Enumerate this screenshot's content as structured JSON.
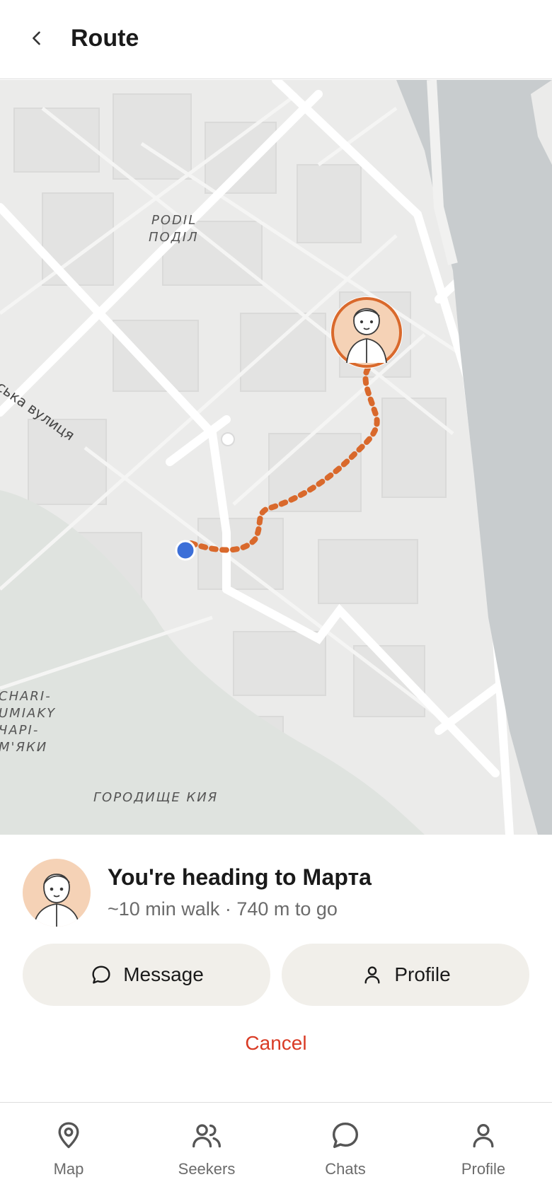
{
  "header": {
    "title": "Route",
    "back_icon": "chevron-left-icon"
  },
  "map": {
    "labels": {
      "district_latin": "PODIL",
      "district_cyrillic": "ПОДІЛ",
      "street": "ківська вулиця",
      "area_1": "CHARI-",
      "area_2": "UMIAKY",
      "area_3": "ЧАРІ-",
      "area_4": "М'ЯКИ",
      "landmark": "ГОРОДИЩЕ КИЯ"
    },
    "route_color": "#d9692c",
    "user_location_color": "#3c6fd8",
    "water_color": "#c8ccce"
  },
  "destination": {
    "title": "You're heading to Марта",
    "subtitle": "~10 min walk · 740 m to go",
    "avatar_bg": "#f5d2b6"
  },
  "actions": {
    "message_label": "Message",
    "message_icon": "chat-bubble-icon",
    "profile_label": "Profile",
    "profile_icon": "person-icon",
    "cancel_label": "Cancel",
    "cancel_color": "#d93b25"
  },
  "tabs": [
    {
      "label": "Map",
      "icon": "map-pin-icon"
    },
    {
      "label": "Seekers",
      "icon": "people-icon"
    },
    {
      "label": "Chats",
      "icon": "chat-bubble-icon"
    },
    {
      "label": "Profile",
      "icon": "person-icon"
    }
  ]
}
